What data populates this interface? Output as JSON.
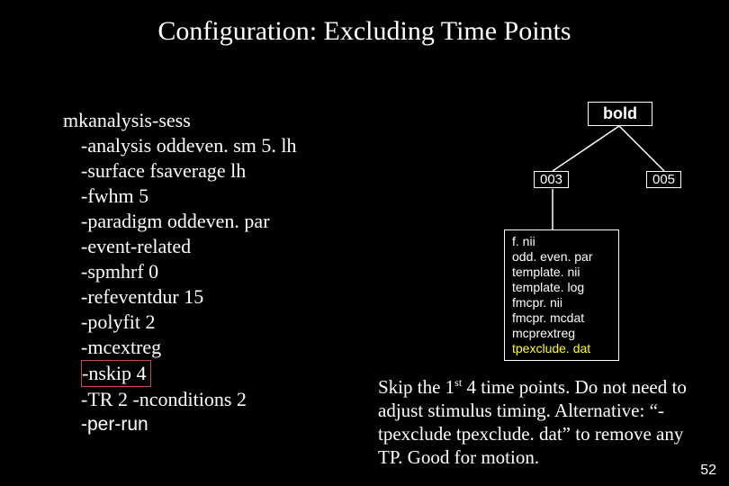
{
  "title": "Configuration: Excluding Time Points",
  "cmd": {
    "l0": "mkanalysis-sess",
    "l1": "-analysis oddeven. sm 5. lh",
    "l2": "-surface fsaverage lh",
    "l3": "-fwhm 5",
    "l4": "-paradigm oddeven. par",
    "l5": "-event-related",
    "l6": "-spmhrf 0",
    "l7": "-refeventdur 15",
    "l8": "-polyfit 2",
    "l9": "-mcextreg",
    "l10": "-nskip 4",
    "l11": "-TR 2 -nconditions 2",
    "l12": "-per-run"
  },
  "diagram": {
    "bold": "bold",
    "n003": "003",
    "n005": "005",
    "files": {
      "f0": "f. nii",
      "f1": "odd. even. par",
      "f2": "template. nii",
      "f3": "template. log",
      "f4": "fmcpr. nii",
      "f5": "fmcpr. mcdat",
      "f6": "mcprextreg",
      "f7": "tpexclude. dat"
    }
  },
  "body": {
    "pre": "Skip the 1",
    "sup": "st",
    "post": " 4 time points. Do not need to adjust stimulus timing. Alternative: “-tpexclude tpexclude. dat” to remove any TP. Good for motion."
  },
  "slidenum": "52"
}
